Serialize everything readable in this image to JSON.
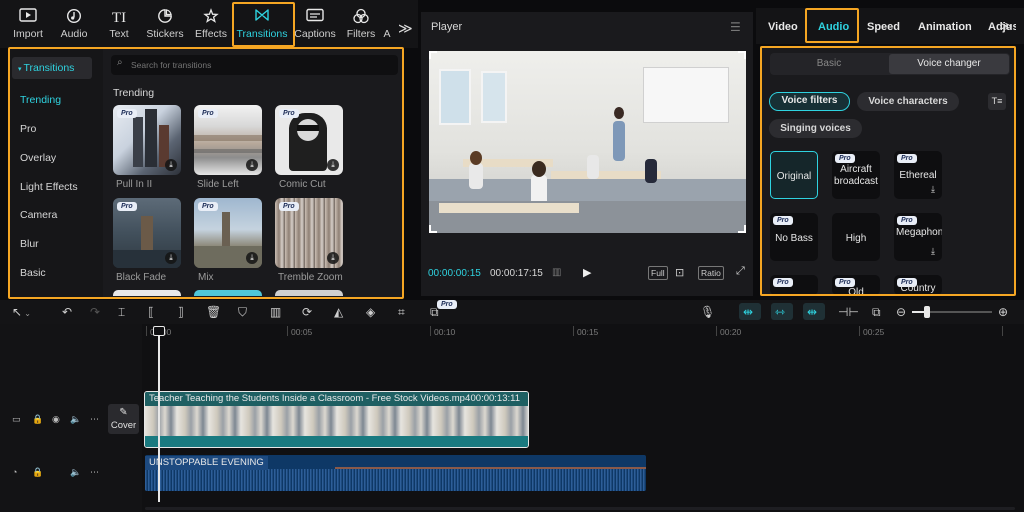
{
  "toolbar": {
    "tabs": [
      {
        "label": "Import",
        "icon": "import-icon",
        "glyph": "▶"
      },
      {
        "label": "Audio",
        "icon": "audio-icon",
        "glyph": "◔"
      },
      {
        "label": "Text",
        "icon": "text-icon",
        "glyph": "TI"
      },
      {
        "label": "Stickers",
        "icon": "sticker-icon",
        "glyph": "◷"
      },
      {
        "label": "Effects",
        "icon": "effects-icon",
        "glyph": "✧"
      },
      {
        "label": "Transitions",
        "icon": "transitions-icon",
        "glyph": "⋈"
      },
      {
        "label": "Captions",
        "icon": "captions-icon",
        "glyph": "▭"
      },
      {
        "label": "Filters",
        "icon": "filters-icon",
        "glyph": "❀"
      },
      {
        "label": "A",
        "icon": "adjustment-icon",
        "glyph": ""
      }
    ],
    "more": "≫"
  },
  "transitions_panel": {
    "header": "Transitions",
    "categories": [
      "Trending",
      "Pro",
      "Overlay",
      "Light Effects",
      "Camera",
      "Blur",
      "Basic"
    ],
    "search_placeholder": "Search for transitions",
    "section_title": "Trending",
    "pro_badge": "Pro",
    "items": [
      "Pull In II",
      "Slide Left",
      "Comic Cut",
      "Black Fade",
      "Mix",
      "Tremble Zoom"
    ]
  },
  "player": {
    "title": "Player",
    "current_time": "00:00:00:15",
    "duration": "00:00:17:15",
    "full_label": "Full",
    "ratio_label": "Ratio"
  },
  "right_panel": {
    "tabs": [
      "Video",
      "Audio",
      "Speed",
      "Animation",
      "Adjus"
    ],
    "segment": {
      "basic": "Basic",
      "voice_changer": "Voice changer"
    },
    "chips": [
      "Voice filters",
      "Voice characters",
      "Singing voices"
    ],
    "pro_badge": "Pro",
    "voices": [
      "Original",
      "Aircraft broadcast",
      "Ethereal",
      "No Bass",
      "High",
      "Megaphone",
      "",
      "Old",
      "Country"
    ]
  },
  "timeline": {
    "ticks": [
      "00:00",
      "00:05",
      "00:10",
      "00:15",
      "00:20",
      "00:25"
    ],
    "video_clip_title": "Teacher Teaching the Students Inside a Classroom - Free Stock Videos.mp4",
    "video_clip_duration": "00:00:13:11",
    "audio_clip_title": "UNSTOPPABLE EVENING",
    "cover_label": "Cover",
    "pro_badge": "Pro"
  }
}
